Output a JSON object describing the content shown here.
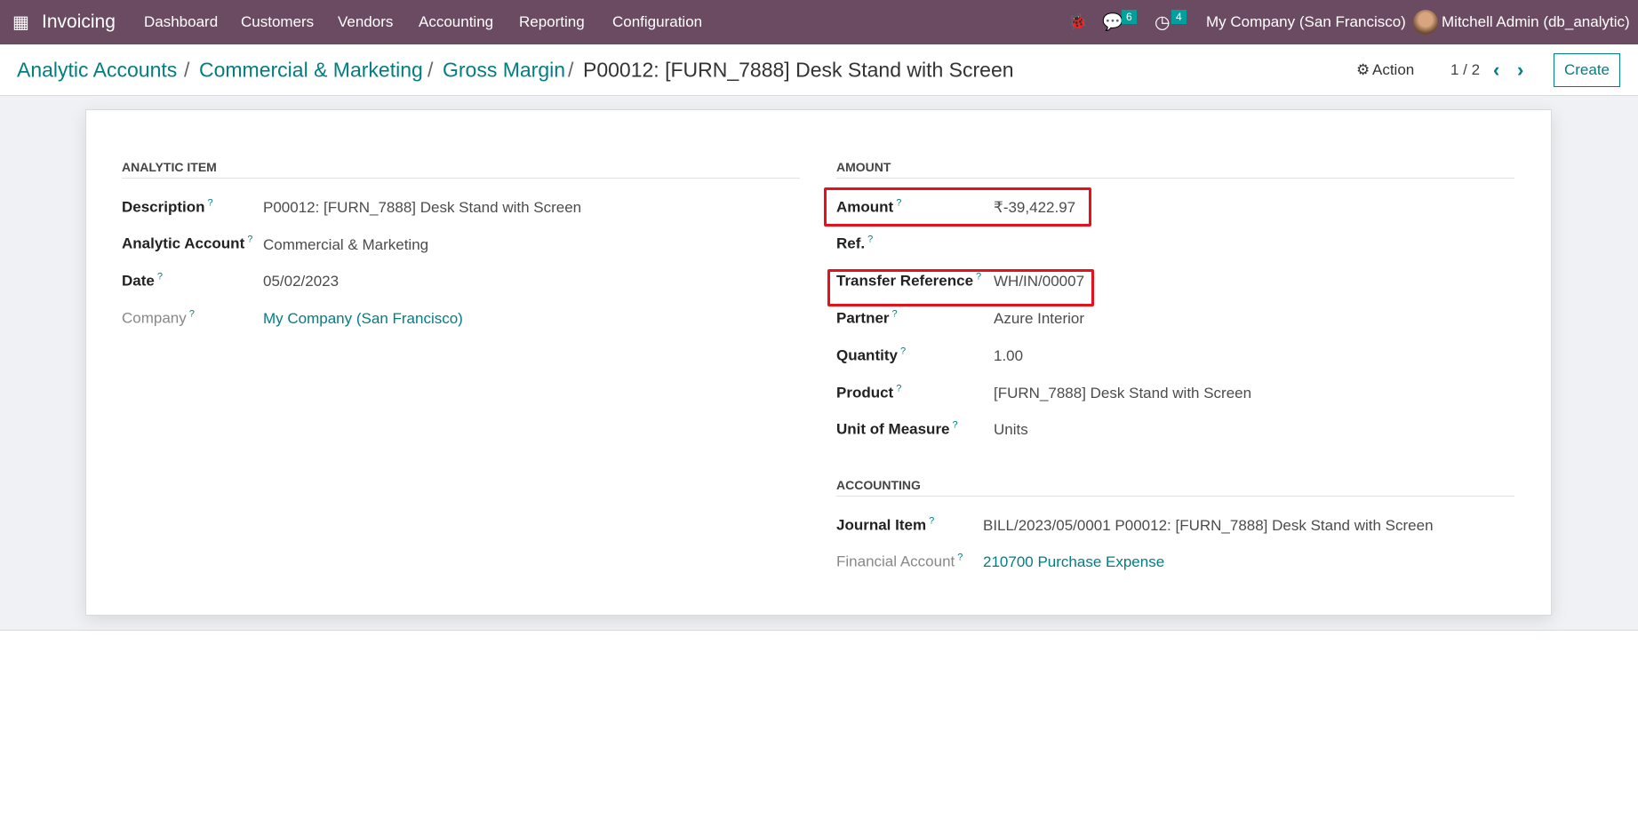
{
  "nav": {
    "app": "Invoicing",
    "menu": [
      "Dashboard",
      "Customers",
      "Vendors",
      "Accounting",
      "Reporting",
      "Configuration"
    ],
    "messages_count": "6",
    "activities_count": "4",
    "company": "My Company (San Francisco)",
    "user": "Mitchell Admin (db_analytic)"
  },
  "breadcrumb": {
    "items": [
      "Analytic Accounts",
      "Commercial & Marketing",
      "Gross Margin"
    ],
    "current": "P00012: [FURN_7888] Desk Stand with Screen",
    "separator": "/"
  },
  "controls": {
    "action": "Action",
    "pager": "1 / 2",
    "create": "Create"
  },
  "analytic_item": {
    "title": "ANALYTIC ITEM",
    "fields": [
      {
        "label": "Description",
        "value": "P00012: [FURN_7888] Desk Stand with Screen"
      },
      {
        "label": "Analytic Account",
        "value": "Commercial & Marketing"
      },
      {
        "label": "Date",
        "value": "05/02/2023"
      },
      {
        "label": "Company",
        "value": "My Company (San Francisco)"
      }
    ]
  },
  "amount": {
    "title": "AMOUNT",
    "fields": [
      {
        "label": "Amount",
        "value": "₹-39,422.97"
      },
      {
        "label": "Ref.",
        "value": ""
      },
      {
        "label": "Transfer Reference",
        "value": "WH/IN/00007"
      },
      {
        "label": "Partner",
        "value": "Azure Interior"
      },
      {
        "label": "Quantity",
        "value": "1.00"
      },
      {
        "label": "Product",
        "value": "[FURN_7888] Desk Stand with Screen"
      },
      {
        "label": "Unit of Measure",
        "value": "Units"
      }
    ]
  },
  "accounting": {
    "title": "ACCOUNTING",
    "fields": [
      {
        "label": "Journal Item",
        "value": "BILL/2023/05/0001 P00012: [FURN_7888] Desk Stand with Screen"
      },
      {
        "label": "Financial Account",
        "value": "210700 Purchase Expense"
      }
    ]
  },
  "help_mark": "?"
}
